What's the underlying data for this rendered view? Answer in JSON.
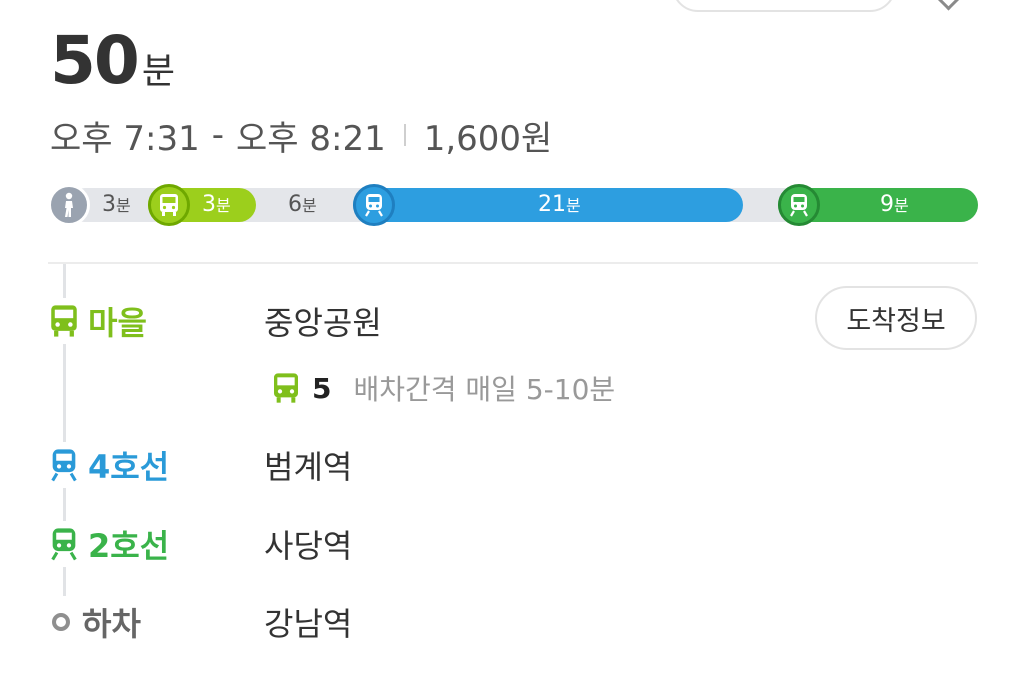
{
  "summary": {
    "total_number": "50",
    "total_unit": "분",
    "depart_time": "오후 7:31",
    "dash": "-",
    "arrive_time": "오후 8:21",
    "fare": "1,600원"
  },
  "timeline": {
    "segments": [
      {
        "mode": "walk",
        "icon": "walk-icon",
        "value": "3",
        "unit": "분"
      },
      {
        "mode": "village-bus",
        "icon": "bus-icon",
        "value": "3",
        "unit": "분",
        "color": "#9ccf1c"
      },
      {
        "mode": "transfer-walk",
        "value": "6",
        "unit": "분"
      },
      {
        "mode": "subway-line-4",
        "icon": "subway-icon",
        "value": "21",
        "unit": "분",
        "color": "#2d9ee0"
      },
      {
        "mode": "subway-line-2",
        "icon": "subway-icon",
        "value": "9",
        "unit": "분",
        "color": "#3ab34a"
      }
    ]
  },
  "route": {
    "steps": [
      {
        "mode_label": "마을",
        "icon": "bus-icon",
        "station": "중앙공원",
        "color": "#7fbf1c"
      },
      {
        "mode_label": "4호선",
        "icon": "subway-icon",
        "station": "범계역",
        "color": "#2a9ad8"
      },
      {
        "mode_label": "2호선",
        "icon": "subway-icon",
        "station": "사당역",
        "color": "#3ab34a"
      },
      {
        "mode_label": "하차",
        "icon": "alight-dot-icon",
        "station": "강남역",
        "color": "#666666"
      }
    ],
    "arrival_button": "도착정보",
    "bus_number": "5",
    "bus_interval": "배차간격 매일 5-10분"
  }
}
